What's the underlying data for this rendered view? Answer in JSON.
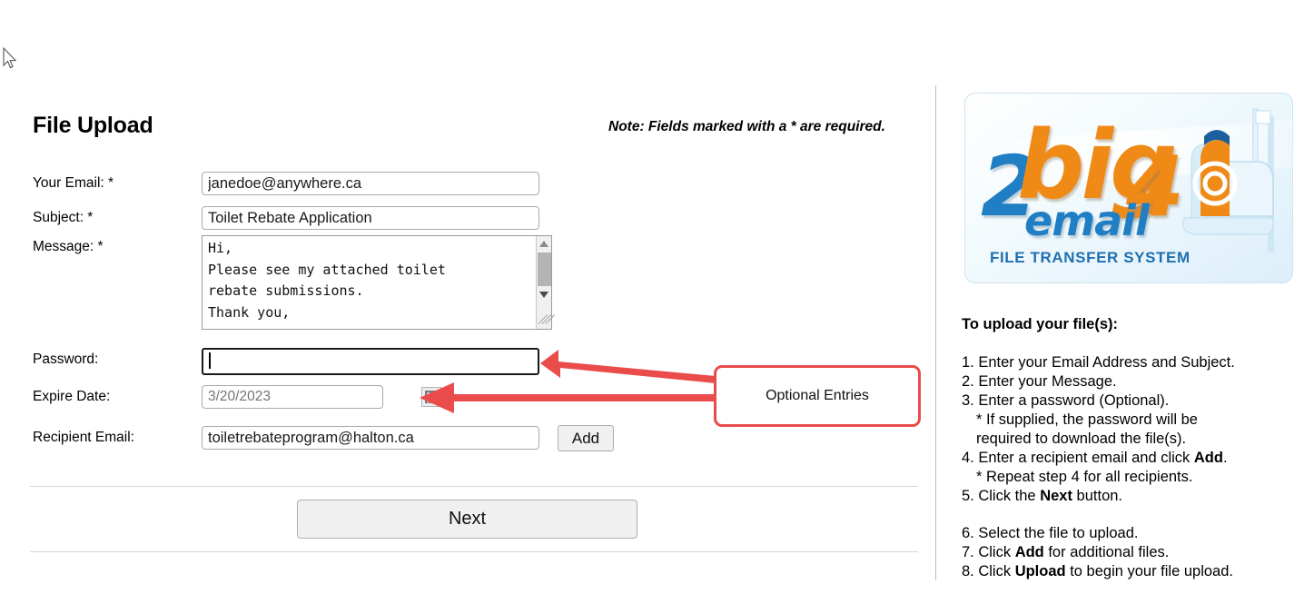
{
  "page": {
    "title": "File Upload",
    "required_note": "Note: Fields marked with a * are required."
  },
  "form": {
    "fields": [
      {
        "label": "Your Email: *",
        "value": "janedoe@anywhere.ca"
      },
      {
        "label": "Subject: *",
        "value": "Toilet Rebate Application"
      },
      {
        "label": "Message: *",
        "value": "Hi,\nPlease see my attached toilet\nrebate submissions.\nThank you,"
      },
      {
        "label": "Password:",
        "value": ""
      },
      {
        "label": "Expire Date:",
        "placeholder": "3/20/2023"
      },
      {
        "label": "Recipient Email:",
        "value": "toiletrebateprogram@halton.ca"
      }
    ],
    "add_button": "Add",
    "next_button": "Next"
  },
  "callout": {
    "text": "Optional Entries",
    "border_color": "#ea4b4b",
    "arrow_color": "#ea4b4b"
  },
  "sidebar": {
    "logo": {
      "part_2": "2",
      "part_big": "big",
      "part_4": "4",
      "part_email": "email",
      "caption": "FILE TRANSFER SYSTEM",
      "blue": "#1f7ec4",
      "orange": "#f08a17"
    },
    "howto_title": "To upload your file(s):",
    "steps": [
      {
        "text": "1. Enter your Email Address and Subject.",
        "indent": false,
        "gap": false
      },
      {
        "text": "2. Enter your Message.",
        "indent": false,
        "gap": false
      },
      {
        "text": "3. Enter a password (Optional).",
        "indent": false,
        "gap": false
      },
      {
        "text": "* If supplied, the password will be",
        "indent": true,
        "gap": false
      },
      {
        "text": "required to download the file(s).",
        "indent": true,
        "gap": false
      },
      {
        "html": "4. Enter a recipient email and click <b>Add</b>.",
        "indent": false,
        "gap": false
      },
      {
        "text": "* Repeat step 4 for all recipients.",
        "indent": true,
        "gap": false
      },
      {
        "html": "5. Click the <b>Next</b> button.",
        "indent": false,
        "gap": false
      },
      {
        "html": "6. Select the file to upload.",
        "indent": false,
        "gap": true
      },
      {
        "html": "7. Click <b>Add</b> for additional files.",
        "indent": false,
        "gap": false
      },
      {
        "html": "8. Click <b>Upload</b> to begin your file upload.",
        "indent": false,
        "gap": false
      }
    ]
  }
}
